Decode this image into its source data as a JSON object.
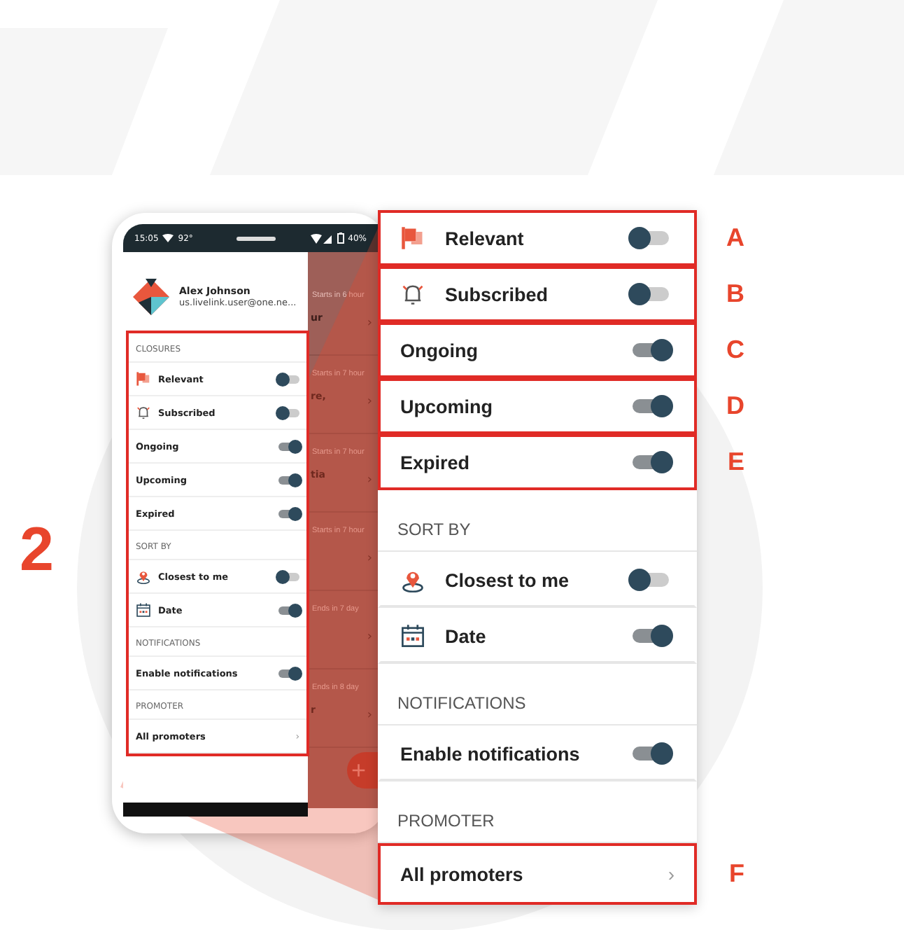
{
  "callout_number": "2",
  "phone": {
    "status_bar": {
      "time": "15:05",
      "temperature": "92°",
      "battery": "40%"
    },
    "profile": {
      "name": "Alex Johnson",
      "email": "us.livelink.user@one.ne..."
    },
    "background_list": [
      {
        "status": "Starts in 6 hour",
        "title": "ur",
        "chevron": "›"
      },
      {
        "status": "Starts in 7 hour",
        "title": "re,",
        "chevron": "›"
      },
      {
        "status": "Starts in 7 hour",
        "title": "tia",
        "chevron": "›"
      },
      {
        "status": "Starts in 7 hour",
        "chevron": "›"
      },
      {
        "status": "Ends in 7 day",
        "chevron": "›"
      },
      {
        "status": "Ends in 8 day",
        "title": "r",
        "chevron": "›"
      }
    ],
    "fab": "+",
    "drawer": {
      "highlighted": true,
      "rows": [
        {
          "kind": "header",
          "label": "CLOSURES"
        },
        {
          "kind": "toggle",
          "label": "Relevant",
          "on": false
        },
        {
          "kind": "toggle",
          "label": "Subscribed",
          "on": false
        },
        {
          "kind": "toggle",
          "label": "Ongoing",
          "on": true
        },
        {
          "kind": "toggle",
          "label": "Upcoming",
          "on": true
        },
        {
          "kind": "toggle",
          "label": "Expired",
          "on": true
        },
        {
          "kind": "header",
          "label": "SORT BY"
        },
        {
          "kind": "toggle",
          "label": "Closest to me",
          "on": false
        },
        {
          "kind": "toggle",
          "label": "Date",
          "on": true
        },
        {
          "kind": "header",
          "label": "NOTIFICATIONS"
        },
        {
          "kind": "toggle",
          "label": "Enable notifications",
          "on": true
        },
        {
          "kind": "header",
          "label": "PROMOTER"
        },
        {
          "kind": "link",
          "label": "All promoters",
          "chevron": "›"
        }
      ]
    }
  },
  "zoom_panel": {
    "rows": [
      {
        "kind": "toggle",
        "label": "Relevant",
        "on": false,
        "highlighted": true,
        "marker": "A"
      },
      {
        "kind": "toggle",
        "label": "Subscribed",
        "on": false,
        "highlighted": true,
        "marker": "B"
      },
      {
        "kind": "toggle",
        "label": "Ongoing",
        "on": true,
        "highlighted": true,
        "marker": "C"
      },
      {
        "kind": "toggle",
        "label": "Upcoming",
        "on": true,
        "highlighted": true,
        "marker": "D"
      },
      {
        "kind": "toggle",
        "label": "Expired",
        "on": true,
        "highlighted": true,
        "marker": "E"
      },
      {
        "kind": "header",
        "label": "SORT BY"
      },
      {
        "kind": "toggle",
        "label": "Closest to me",
        "on": false,
        "highlighted": false
      },
      {
        "kind": "toggle",
        "label": "Date",
        "on": true,
        "highlighted": false
      },
      {
        "kind": "header",
        "label": "NOTIFICATIONS"
      },
      {
        "kind": "toggle",
        "label": "Enable notifications",
        "on": true,
        "highlighted": false
      },
      {
        "kind": "header",
        "label": "PROMOTER"
      },
      {
        "kind": "link",
        "label": "All promoters",
        "chevron": "›",
        "highlighted": true,
        "marker": "F"
      }
    ]
  }
}
